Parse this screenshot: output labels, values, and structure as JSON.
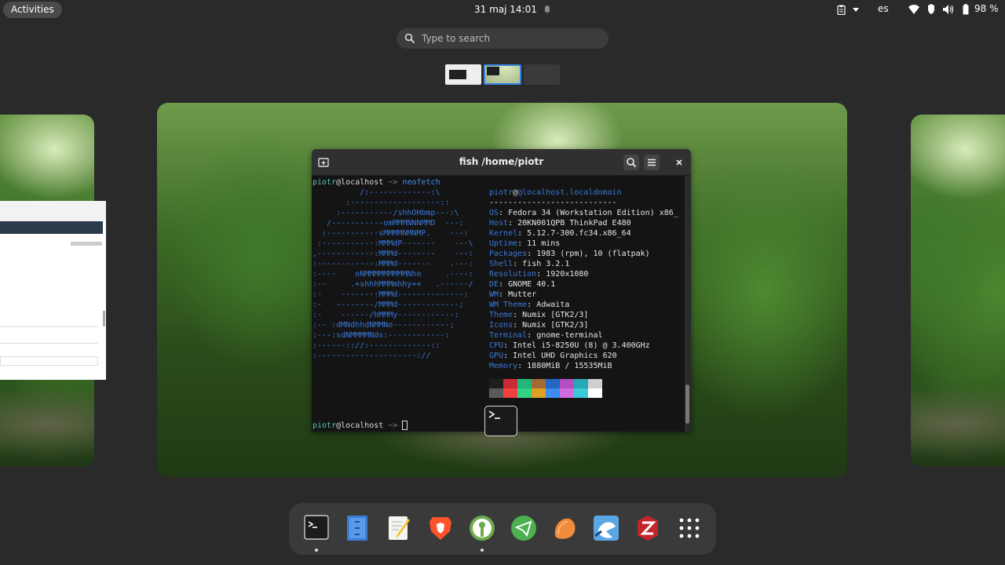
{
  "topbar": {
    "activities": "Activities",
    "clock": "31 maj  14:01",
    "keyboard_layout": "es",
    "battery": "98 %"
  },
  "search": {
    "placeholder": "Type to search"
  },
  "terminal": {
    "title": "fish /home/piotr",
    "cmd_user": "piotr",
    "cmd_host": "@localhost",
    "cmd_arrow": " ~> ",
    "cmd": "neofetch",
    "info_header_user": "piotr",
    "info_header_host": "@localhost.localdomain",
    "info_rule": "---------------------------",
    "info": [
      {
        "k": "OS",
        "v": ": Fedora 34 (Workstation Edition) x86_"
      },
      {
        "k": "Host",
        "v": ": 20KN001QPB ThinkPad E480"
      },
      {
        "k": "Kernel",
        "v": ": 5.12.7-300.fc34.x86_64"
      },
      {
        "k": "Uptime",
        "v": ": 11 mins"
      },
      {
        "k": "Packages",
        "v": ": 1983 (rpm), 10 (flatpak)"
      },
      {
        "k": "Shell",
        "v": ": fish 3.2.1"
      },
      {
        "k": "Resolution",
        "v": ": 1920x1080"
      },
      {
        "k": "DE",
        "v": ": GNOME 40.1"
      },
      {
        "k": "WM",
        "v": ": Mutter"
      },
      {
        "k": "WM Theme",
        "v": ": Adwaita"
      },
      {
        "k": "Theme",
        "v": ": Numix [GTK2/3]"
      },
      {
        "k": "Icons",
        "v": ": Numix [GTK2/3]"
      },
      {
        "k": "Terminal",
        "v": ": gnome-terminal"
      },
      {
        "k": "CPU",
        "v": ": Intel i5-8250U (8) @ 3.400GHz"
      },
      {
        "k": "GPU",
        "v": ": Intel UHD Graphics 620"
      },
      {
        "k": "Memory",
        "v": ": 1880MiB / 15535MiB"
      }
    ],
    "ascii": [
      "          /:-------------:\\",
      "       :-------------------::",
      "     :-----------/shhOHbmp---:\\",
      "   /-----------omMMMNNNMMD  ---:",
      "  :-----------sMMMMNMNMP.    ---:",
      " :-----------:MMMdP-------    ---\\",
      ",------------:MMMd--------    ---:",
      ":------------:MMMd-------    .---:",
      ":----    oNMMMMMMMMMNho     .----:",
      ":--     .+shhhMMMmhhy++   .------/",
      ":-    -------:MMMd--------------:",
      ":-   --------/MMMd-------------;",
      ":-    ------/hMMMy------------:",
      ":-- :dMNdhhdNMMNo------------;",
      ":---:sdNMMMMNds:------------:",
      ":------:://:-------------::",
      ":---------------------://"
    ],
    "prompt_end": " ~> ",
    "colors_top": [
      "#1e1e1e",
      "#cc2936",
      "#21b67a",
      "#a26b33",
      "#2366c4",
      "#b44fc1",
      "#2aa7b5",
      "#cfcfcf"
    ],
    "colors_bottom": [
      "#5a5a5a",
      "#f04040",
      "#33d184",
      "#e0a020",
      "#3f8cf0",
      "#d26ae0",
      "#3ccad8",
      "#ffffff"
    ]
  },
  "dock": {
    "apps": [
      "terminal-app",
      "files-app",
      "text-editor-app",
      "brave-app",
      "keepassxc-app",
      "telegram-app",
      "mango-app",
      "kite-app",
      "zotero-app",
      "app-grid"
    ]
  },
  "colors": {
    "topbar": "#2a2a2a",
    "accent_blue": "#3a78d8",
    "selected_workspace": "#3584e4"
  }
}
